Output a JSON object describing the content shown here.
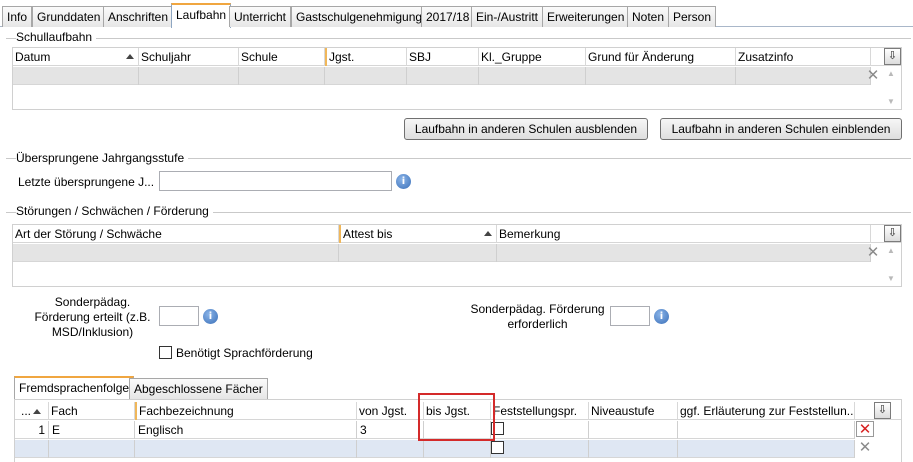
{
  "tabs": [
    {
      "label": "Info",
      "active": false
    },
    {
      "label": "Grunddaten",
      "active": false
    },
    {
      "label": "Anschriften",
      "active": false
    },
    {
      "label": "Laufbahn",
      "active": true
    },
    {
      "label": "Unterricht",
      "active": false
    },
    {
      "label": "Gastschulgenehmigung",
      "active": false
    },
    {
      "label": "2017/18",
      "active": false
    },
    {
      "label": "Ein-/Austritt",
      "active": false
    },
    {
      "label": "Erweiterungen",
      "active": false
    },
    {
      "label": "Noten",
      "active": false
    },
    {
      "label": "Person",
      "active": false
    }
  ],
  "schullaufbahn": {
    "caption": "Schullaufbahn",
    "columns": [
      "Datum",
      "Schuljahr",
      "Schule",
      "Jgst.",
      "SBJ",
      "Kl._Gruppe",
      "Grund für Änderung",
      "Zusatzinfo"
    ],
    "hide_button": "Laufbahn in anderen Schulen ausblenden",
    "show_button": "Laufbahn in anderen Schulen einblenden"
  },
  "uebersprungen": {
    "caption": "Übersprungene Jahrgangsstufe",
    "field_label": "Letzte übersprungene J...",
    "field_value": ""
  },
  "stoerungen": {
    "caption": "Störungen / Schwächen / Förderung",
    "columns": [
      "Art der Störung / Schwäche",
      "Attest bis",
      "Bemerkung"
    ]
  },
  "foerderung": {
    "erteilt_label": "Sonderpädag. Förderung erteilt (z.B. MSD/Inklusion)",
    "erteilt_value": "",
    "erforderlich_label": "Sonderpädag. Förderung erforderlich",
    "erforderlich_value": "",
    "sprach_label": "Benötigt Sprachförderung",
    "sprach_checked": false
  },
  "lower_tabs": [
    {
      "label": "Fremdsprachenfolge",
      "active": true
    },
    {
      "label": "Abgeschlossene Fächer",
      "active": false
    }
  ],
  "fremdsprachen": {
    "columns": [
      "...",
      "Fach",
      "Fachbezeichnung",
      "von Jgst.",
      "bis Jgst.",
      "Feststellungspr.",
      "Niveaustufe",
      "ggf. Erläuterung zur Feststellun..."
    ],
    "rows": [
      {
        "nr": "1",
        "fach": "E",
        "bezeichnung": "Englisch",
        "von": "3",
        "bis": "",
        "feststellung": false,
        "niveau": "",
        "erlaeuterung": ""
      }
    ]
  }
}
